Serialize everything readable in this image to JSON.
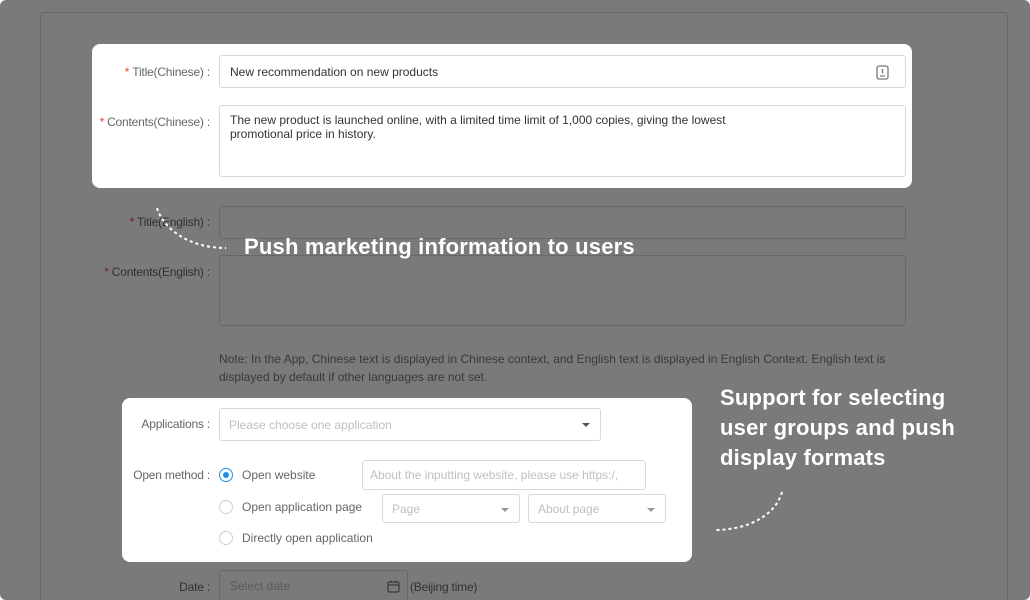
{
  "form": {
    "title_cn": {
      "label": "Title(Chinese) :",
      "value": "New recommendation on new products"
    },
    "content_cn": {
      "label": "Contents(Chinese) :",
      "value": "The new product is launched online, with a limited time limit of 1,000 copies, giving the lowest\npromotional price in history."
    },
    "title_en": {
      "label": "Title(English) :",
      "value": ""
    },
    "content_en": {
      "label": "Contents(English) :",
      "value": ""
    },
    "note": "Note: In the App, Chinese text is displayed in Chinese context, and English text is displayed in English Context. English text is displayed by default if other languages are not set.",
    "applications": {
      "label": "Applications :",
      "placeholder": "Please choose one application"
    },
    "open_method": {
      "label": "Open method :",
      "options": [
        {
          "label": "Open website",
          "selected": true
        },
        {
          "label": "Open application page",
          "selected": false
        },
        {
          "label": "Directly open application",
          "selected": false
        }
      ],
      "website_placeholder": "About the inputting website, please use https:/,",
      "page_select": "Page",
      "about_select": "About page"
    },
    "date": {
      "label": "Date :",
      "placeholder": "Select date",
      "suffix": "(Beijing time)"
    }
  },
  "callouts": {
    "push": "Push marketing information to users",
    "support": [
      "Support for selecting",
      "user groups and push",
      "display formats"
    ]
  },
  "colors": {
    "accent": "#1f90e6",
    "required": "#f04134",
    "overlay": "#000000"
  }
}
